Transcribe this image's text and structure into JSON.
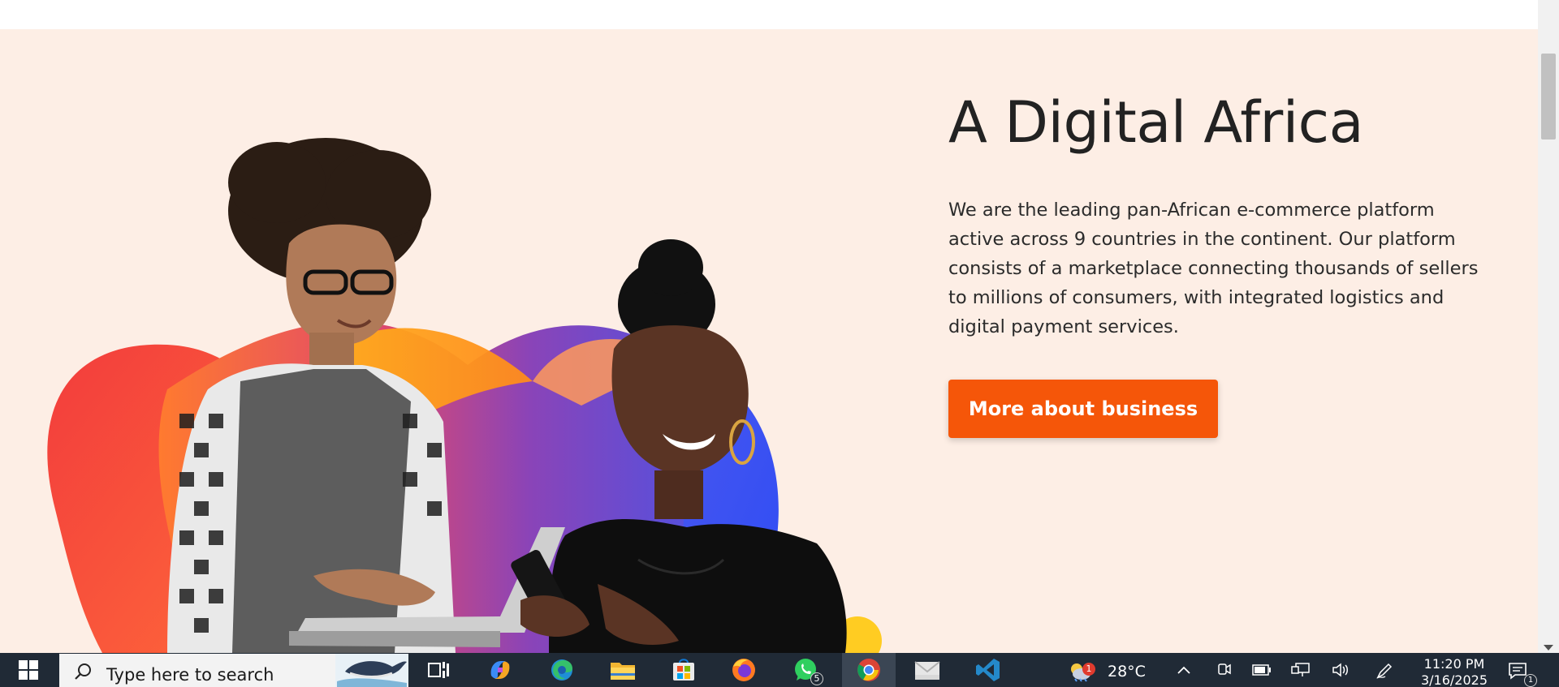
{
  "hero": {
    "title": "A Digital Africa",
    "description": "We are the leading pan-African e-commerce platform active across 9 countries in the continent. Our platform consists of a marketplace connecting thousands of sellers to millions of consumers, with integrated logistics and digital payment services.",
    "cta_label": "More about business",
    "image": "two-people-with-laptop-and-phone-illustration"
  },
  "colors": {
    "hero_background": "#fdeee5",
    "cta_background": "#f55609",
    "title_text": "#222222",
    "taskbar": "#202a36"
  },
  "taskbar": {
    "search_placeholder": "Type here to search",
    "apps": [
      {
        "name": "task-view",
        "icon": "task-view-icon"
      },
      {
        "name": "copilot",
        "icon": "copilot-icon"
      },
      {
        "name": "edge",
        "icon": "edge-icon"
      },
      {
        "name": "file-explorer",
        "icon": "folder-icon"
      },
      {
        "name": "microsoft-store",
        "icon": "store-icon"
      },
      {
        "name": "firefox",
        "icon": "firefox-icon"
      },
      {
        "name": "whatsapp",
        "icon": "whatsapp-icon",
        "badge": "5"
      },
      {
        "name": "chrome",
        "icon": "chrome-icon"
      },
      {
        "name": "mail",
        "icon": "mail-icon"
      },
      {
        "name": "vscode",
        "icon": "vscode-icon"
      }
    ],
    "weather": {
      "temp": "28°C",
      "badge": "1",
      "icon": "weather-icon"
    },
    "clock": {
      "time": "11:20 PM",
      "date": "3/16/2025"
    },
    "notification_count": "1"
  }
}
